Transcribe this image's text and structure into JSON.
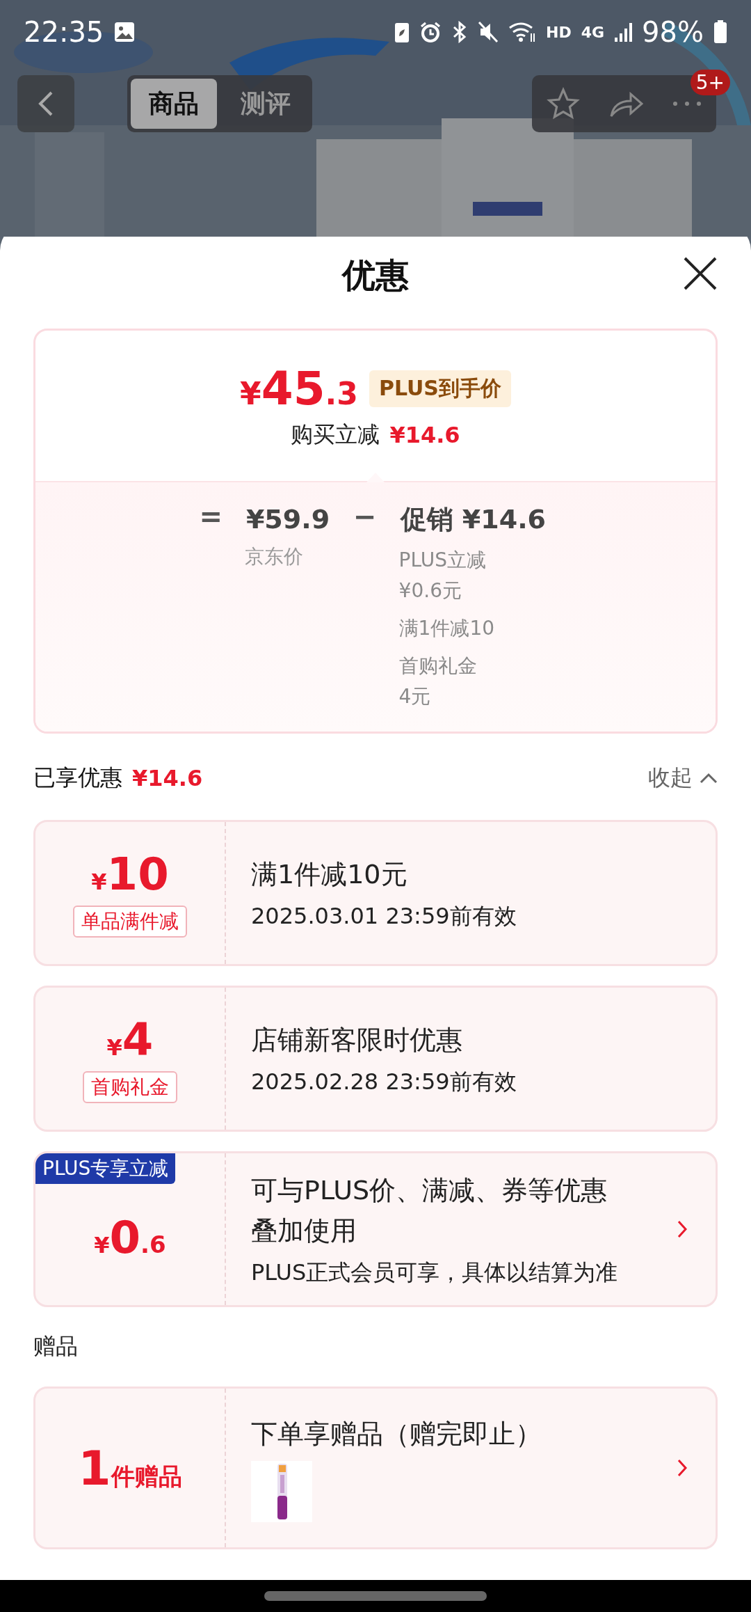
{
  "status_bar": {
    "time": "22:35",
    "hd_label": "HD",
    "network_label": "4G",
    "battery": "98%"
  },
  "nav": {
    "tabs": [
      {
        "label": "商品",
        "selected": true
      },
      {
        "label": "测评",
        "selected": false
      }
    ],
    "badge": "5+"
  },
  "sheet": {
    "title": "优惠"
  },
  "summary": {
    "symbol": "¥",
    "price_int": "45",
    "price_dec": ".3",
    "price_tag": "PLUS到手价",
    "saving_label": "购买立减",
    "saving_value": "¥14.6"
  },
  "breakdown": {
    "equals": "=",
    "base_price": "¥59.9",
    "base_label": "京东价",
    "minus": "−",
    "promo_label": "促销",
    "promo_value": "¥14.6",
    "details": [
      {
        "lines": [
          "PLUS立减",
          "¥0.6元"
        ]
      },
      {
        "lines": [
          "满1件减10"
        ]
      },
      {
        "lines": [
          "首购礼金",
          "4元"
        ]
      }
    ]
  },
  "enjoyed": {
    "label": "已享优惠",
    "value": "¥14.6",
    "toggle": "收起",
    "expanded": true
  },
  "coupons": [
    {
      "kind": "amount",
      "symbol": "¥",
      "amount": "10",
      "tag": "单品满件减",
      "title_lines": [
        "满1件减10元"
      ],
      "subtitle": "2025.03.01 23:59前有效",
      "has_arrow": false
    },
    {
      "kind": "amount",
      "symbol": "¥",
      "amount": "4",
      "tag": "首购礼金",
      "title_lines": [
        "店铺新客限时优惠"
      ],
      "subtitle": "2025.02.28 23:59前有效",
      "has_arrow": false
    },
    {
      "kind": "plus",
      "ribbon": "PLUS专享立减",
      "symbol": "¥",
      "amount": "0",
      "decimal": ".6",
      "title_lines": [
        "可与PLUS价、满减、券等优惠",
        "叠加使用"
      ],
      "subtitle": "PLUS正式会员可享，具体以结算为准",
      "has_arrow": true
    }
  ],
  "gifts": {
    "label": "赠品",
    "count": "1",
    "unit": "件赠品",
    "title": "下单享赠品（赠完即止）",
    "has_arrow": true
  }
}
